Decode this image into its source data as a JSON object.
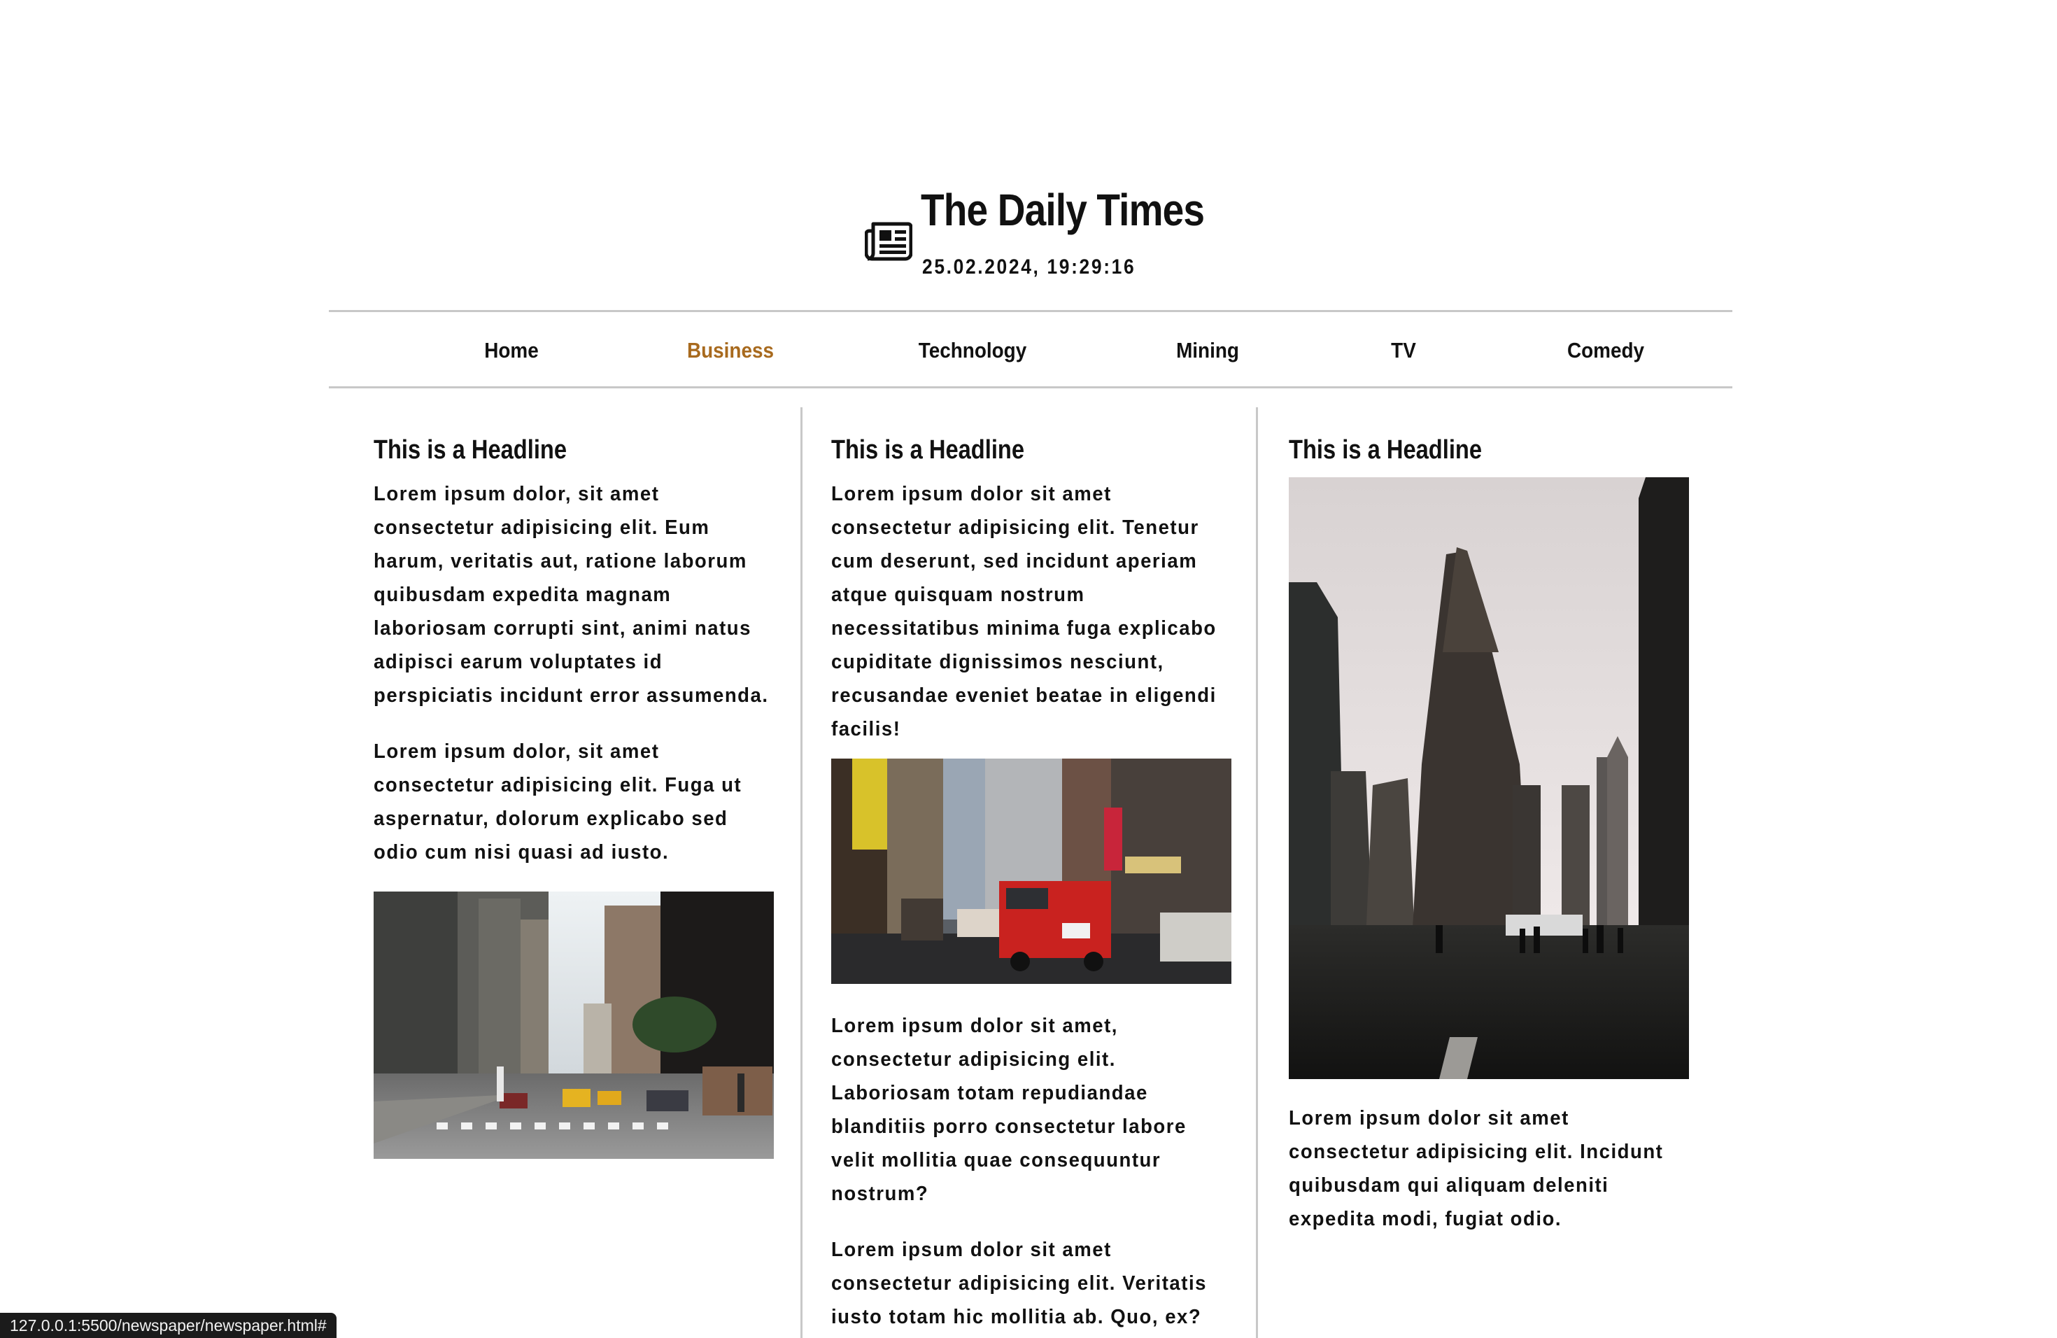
{
  "header": {
    "title": "The Daily Times",
    "datetime": "25.02.2024, 19:29:16",
    "logo_icon": "newspaper-icon"
  },
  "nav": {
    "items": [
      {
        "label": "Home",
        "active": false
      },
      {
        "label": "Business",
        "active": true
      },
      {
        "label": "Technology",
        "active": false
      },
      {
        "label": "Mining",
        "active": false
      },
      {
        "label": "TV",
        "active": false
      },
      {
        "label": "Comedy",
        "active": false
      }
    ],
    "active_color": "#a86a1e"
  },
  "articles": [
    {
      "headline": "This is a Headline",
      "paragraphs": [
        "Lorem ipsum dolor, sit amet consectetur adipisicing elit. Eum harum, veritatis aut, ratione laborum quibusdam expedita magnam laboriosam corrupti sint, animi natus adipisci earum voluptates id perspiciatis incidunt error assumenda.",
        "Lorem ipsum dolor, sit amet consectetur adipisicing elit. Fuga ut aspernatur, dolorum explicabo sed odio cum nisi quasi ad iusto."
      ],
      "image": "street-crosswalk-photo"
    },
    {
      "headline": "This is a Headline",
      "paragraphs": [
        "Lorem ipsum dolor sit amet consectetur adipisicing elit. Tenetur cum deserunt, sed incidunt aperiam atque quisquam nostrum necessitatibus minima fuga explicabo cupiditate dignissimos nesciunt, recusandae eveniet beatae in eligendi facilis!",
        "Lorem ipsum dolor sit amet, consectetur adipisicing elit. Laboriosam totam repudiandae blanditiis porro consectetur labore velit mollitia quae consequuntur nostrum?",
        "Lorem ipsum dolor sit amet consectetur adipisicing elit. Veritatis iusto totam hic mollitia ab. Quo, ex?"
      ],
      "image": "fire-truck-street-photo"
    },
    {
      "headline": "This is a Headline",
      "paragraphs": [
        "Lorem ipsum dolor sit amet consectetur adipisicing elit. Incidunt quibusdam qui aliquam deleniti expedita modi, fugiat odio."
      ],
      "image": "flatiron-building-photo"
    }
  ],
  "status_bar": {
    "url": "127.0.0.1:5500/newspaper/newspaper.html#"
  }
}
